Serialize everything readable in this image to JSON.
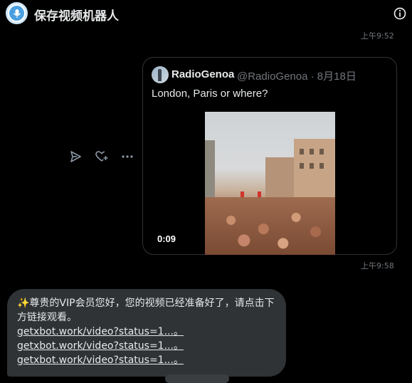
{
  "header": {
    "title": "保存视频机器人",
    "avatar_icon": "microphone-icon",
    "info_icon": "info-icon"
  },
  "messages": {
    "time_1": "上午9:52",
    "time_2": "上午9:58"
  },
  "actions": {
    "share_icon": "send-icon",
    "react_icon": "heart-plus-icon",
    "more_icon": "more-icon"
  },
  "tweet": {
    "author_name": "RadioGenoa",
    "author_handle": "@RadioGenoa · 8月18日",
    "text": "London, Paris or where?",
    "video_duration": "0:09"
  },
  "bot_message": {
    "text": "✨尊贵的VIP会员您好，您的视频已经准备好了，请点击下方链接观看。",
    "links": [
      "getxbot.work/video?status=1...。",
      "getxbot.work/video?status=1...。",
      "getxbot.work/video?status=1...。"
    ]
  },
  "colors": {
    "background": "#000000",
    "bubble": "#2f3336",
    "text": "#e7e9ea",
    "muted": "#71767b"
  }
}
